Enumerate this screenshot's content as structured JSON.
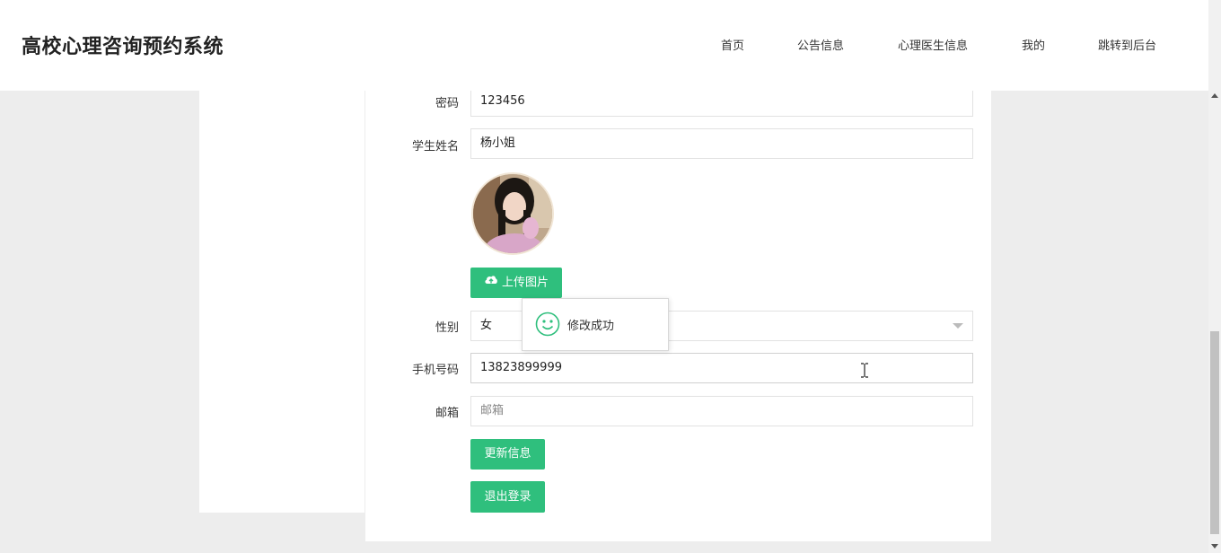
{
  "header": {
    "title": "高校心理咨询预约系统",
    "nav": [
      "首页",
      "公告信息",
      "心理医生信息",
      "我的",
      "跳转到后台"
    ]
  },
  "form": {
    "password": {
      "label": "密码",
      "value": "123456"
    },
    "student_name": {
      "label": "学生姓名",
      "value": "杨小姐"
    },
    "upload_label": "上传图片",
    "gender": {
      "label": "性别",
      "value": "女"
    },
    "phone": {
      "label": "手机号码",
      "value": "13823899999"
    },
    "email": {
      "label": "邮箱",
      "placeholder": "邮箱"
    },
    "update_label": "更新信息",
    "logout_label": "退出登录"
  },
  "toast": {
    "message": "修改成功",
    "icon": "smile-icon"
  },
  "colors": {
    "accent": "#2fbf7d",
    "background": "#ededed"
  }
}
